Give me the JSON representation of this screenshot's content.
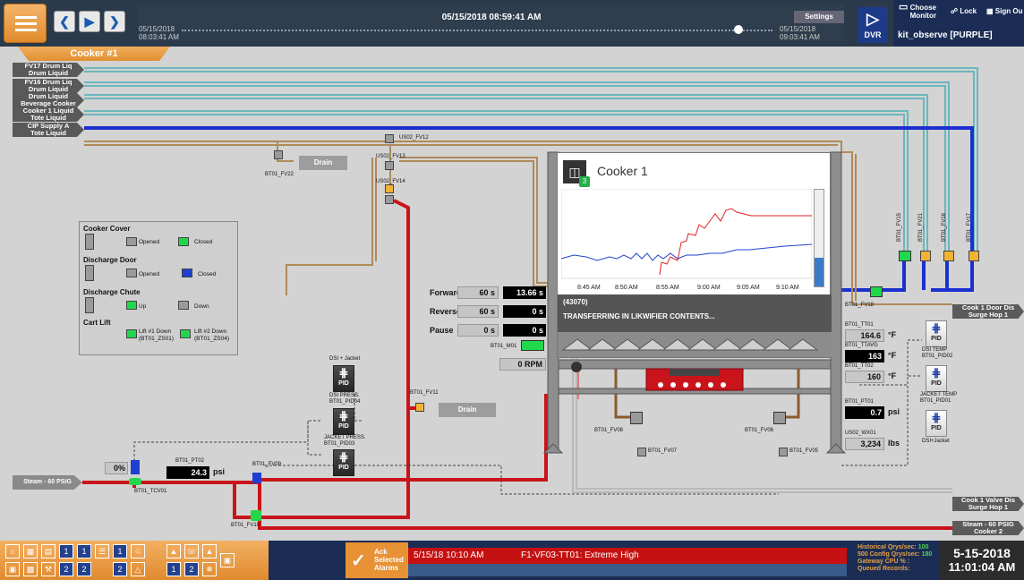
{
  "header": {
    "timeline_time": "05/15/2018 08:59:41 AM",
    "start_date": "05/15/2018",
    "start_time": "08:03:41 AM",
    "end_date": "05/15/2018",
    "end_time": "09:03:41 AM",
    "settings_label": "Settings",
    "dvr_label": "DVR",
    "choose_monitor_line1": "Choose",
    "choose_monitor_line2": "Monitor",
    "lock_label": "Lock",
    "sign_out_label": "Sign Ou",
    "user": "kit_observe [PURPLE]"
  },
  "page_tab": "Cooker #1",
  "sources": [
    {
      "l1": "FV17 Drum Liq",
      "l2": "Drum Liquid"
    },
    {
      "l1": "FV16 Drum Liq",
      "l2": "Drum Liquid"
    },
    {
      "l1": "Drum Liquid",
      "l2": "Beverage Cooker"
    },
    {
      "l1": "Cooker 1 Liquid",
      "l2": "Tote Liquid"
    },
    {
      "l1": "CIP Supply A",
      "l2": "Tote Liquid"
    }
  ],
  "destinations": {
    "door": {
      "l1": "Cook 1 Door Dis",
      "l2": "Surge Hop 1"
    },
    "valve": {
      "l1": "Cook 1 Valve Dis",
      "l2": "Surge Hop 1"
    },
    "steam_out": {
      "l1": "Steam - 60 PSIG",
      "l2": "Cooker 2"
    }
  },
  "steam_in": "Steam - 60 PSIG",
  "legend": {
    "cover": "Cooker Cover",
    "cover_opened": "Opened",
    "cover_closed": "Closed",
    "door": "Discharge Door",
    "door_opened": "Opened",
    "door_closed": "Closed",
    "chute": "Discharge Chute",
    "chute_up": "Up",
    "chute_down": "Down",
    "cart": "Cart Lift",
    "lift1_a": "Lift #1 Down",
    "lift1_b": "(BT01_ZS01)",
    "lift2_a": "Lift #2 Down",
    "lift2_b": "(BT01_ZS04)"
  },
  "tags": {
    "fv22": "BT01_FV22",
    "fv12": "US02_FV12",
    "fv13": "US02_FV13",
    "fv14": "US02_FV14",
    "fv11": "BT01_FV11",
    "fv09": "BT01_FV09",
    "fv10": "BT01_FV10",
    "pt02": "BT01_PT02",
    "tcv01": "BT01_TCV01",
    "fv08": "BT01_FV08",
    "fv07": "BT01_FV07",
    "fv06": "BT01_FV06",
    "fv05": "BT01_FV05",
    "fv18": "BT01_FV18",
    "fv15": "BT01_FV15",
    "fv21": "BT01_FV21",
    "fv16": "BT01_FV16",
    "fv17": "BT01_FV17",
    "tt01": "BT01_TT01",
    "ttavg": "BT01_TTAVG",
    "tt02": "BT01_TT02",
    "pt01": "BT01_PT01",
    "wx01": "US02_WX01",
    "m01": "BT01_M01"
  },
  "drain_label": "Drain",
  "drain2_label": "Drain",
  "controls": {
    "forward_label": "Forward",
    "forward_set": "60 s",
    "forward_val": "13.66 s",
    "reverse_label": "Reverse",
    "reverse_set": "60 s",
    "reverse_val": "0 s",
    "pause_label": "Pause",
    "pause_set": "0 s",
    "pause_val": "0 s",
    "rpm": "0 RPM"
  },
  "pid": {
    "dsi_jacket_top": "DSI + Jacket",
    "pid_label": "PID",
    "dsi_press_a": "DSI PRESS.",
    "dsi_press_b": "BT01_PID04",
    "jacket_press_a": "JACKET PRESS.",
    "jacket_press_b": "BT01_PID03",
    "dsi_temp_a": "DSI TEMP",
    "dsi_temp_b": "BT01_PID02",
    "jacket_temp_a": "JACKET TEMP",
    "jacket_temp_b": "BT01_PID01",
    "dsi_jacket_bottom": "DSI+Jacket"
  },
  "tcv": {
    "pct": "0%",
    "psi": "24.3",
    "unit": "psi"
  },
  "measurements": {
    "tt01": "164.6",
    "ttavg": "163",
    "tt02": "160",
    "temp_unit": "°F",
    "pt01": "0.7",
    "pt01_unit": "psi",
    "wx01": "3,234",
    "wx01_unit": "lbs"
  },
  "cooker": {
    "title": "Cooker 1",
    "badge": "3",
    "status_code": "(43070)",
    "status_text": "TRANSFERRING IN LIKWIFIER CONTENTS...",
    "x_ticks": [
      "8:45 AM",
      "8:50 AM",
      "8:55 AM",
      "9:00 AM",
      "9:05 AM",
      "9:10 AM"
    ],
    "level_pct": 30
  },
  "alarm": {
    "ack_line1": "Ack",
    "ack_line2": "Selected",
    "ack_line3": "Alarms",
    "time": "5/15/18 10:10 AM",
    "text": "F1-VF03-TT01: Extreme High"
  },
  "stats": {
    "historical": "Historical Qrys/sec:",
    "historical_v": "100",
    "config": "500 Config Qrys/sec:",
    "config_v": "180",
    "cpu": "Gateway CPU % :",
    "cpu_v": "",
    "queued": "Queued Records:",
    "queued_v": ""
  },
  "clock": {
    "date": "5-15-2018",
    "time": "11:01:04 AM"
  }
}
